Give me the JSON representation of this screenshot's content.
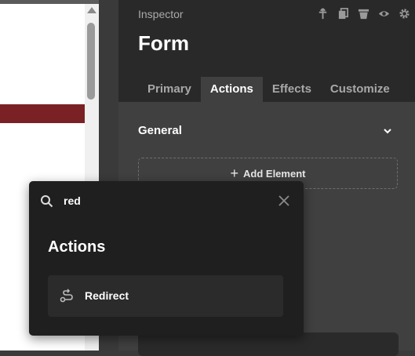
{
  "inspector": {
    "title": "Inspector",
    "element_name": "Form",
    "header_icons": [
      "move-icon",
      "copy-icon",
      "trash-icon",
      "eye-icon",
      "gear-icon"
    ]
  },
  "tabs": [
    {
      "label": "Primary",
      "active": false
    },
    {
      "label": "Actions",
      "active": true
    },
    {
      "label": "Effects",
      "active": false
    },
    {
      "label": "Customize",
      "active": false
    }
  ],
  "section": {
    "title": "General",
    "add_element_label": "Add Element"
  },
  "search": {
    "value": "red",
    "results_heading": "Actions",
    "results": [
      {
        "label": "Redirect",
        "icon": "redirect-icon"
      }
    ]
  },
  "colors": {
    "accent_red": "#7a2125",
    "panel_dark": "#292929",
    "panel": "#404040",
    "popup": "#1f1f1f"
  }
}
